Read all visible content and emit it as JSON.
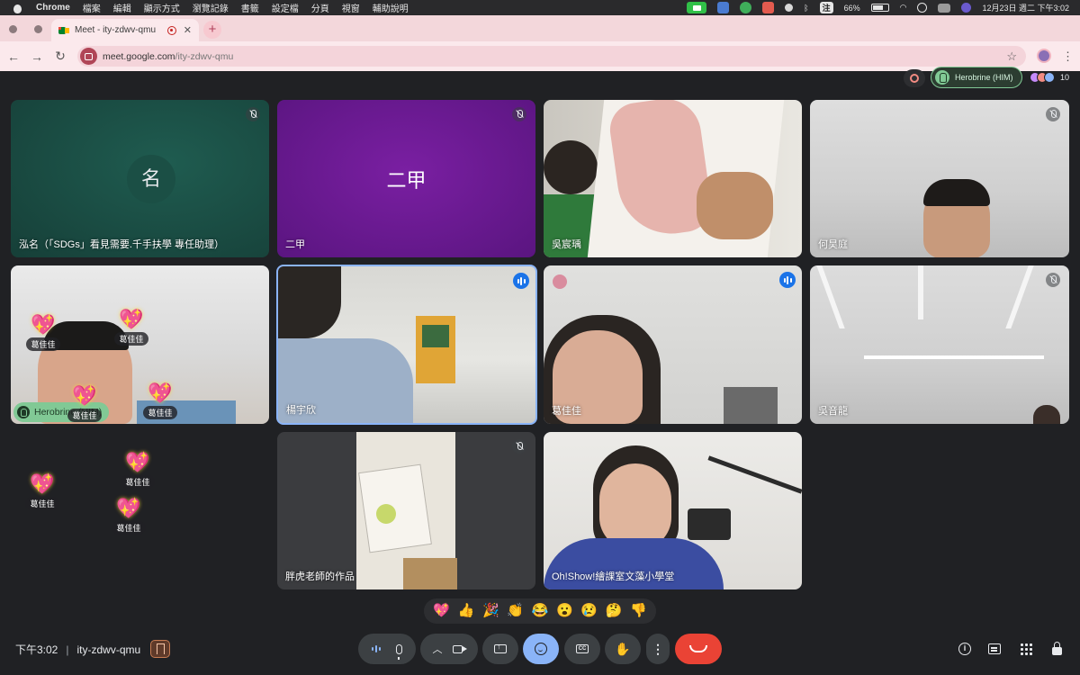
{
  "menubar": {
    "app": "Chrome",
    "items": [
      "檔案",
      "編輯",
      "顯示方式",
      "瀏覽記錄",
      "書籤",
      "設定檔",
      "分頁",
      "視窗",
      "輔助說明"
    ],
    "input_method": "注",
    "battery": "66%",
    "datetime": "12月23日 週二 下午3:02"
  },
  "browser": {
    "tab_title": "Meet - ity-zdwv-qmu",
    "tab_close": "✕",
    "new_tab": "+",
    "url_host": "meet.google.com",
    "url_path": "/ity-zdwv-qmu"
  },
  "meet_top": {
    "hand_raised_name": "Herobrine (HIM)",
    "participant_count": "10"
  },
  "tiles": [
    {
      "name": "泓名（「SDGs」看見需要.千手扶學 專任助理）",
      "avatar": "名",
      "muted": true
    },
    {
      "name": "二甲",
      "avatar": "二甲",
      "muted": true
    },
    {
      "name": "吳宸瑀",
      "muted": false
    },
    {
      "name": "何昊庭",
      "muted": true
    },
    {
      "name": "Herobrine (HIM)",
      "muted": true,
      "hand_raised": true
    },
    {
      "name": "楊宇欣",
      "speaking": true
    },
    {
      "name": "葛佳佳",
      "speaking": true
    },
    {
      "name": "吳音龍",
      "muted": true
    },
    {
      "name": "胖虎老師的作品",
      "muted": true
    },
    {
      "name": "Oh!Show!繪課室文藻小學堂",
      "muted": false
    }
  ],
  "reactions": {
    "sender": "葛佳佳",
    "emoji": "💖"
  },
  "emoji_bar": [
    "💖",
    "👍",
    "🎉",
    "👏",
    "😂",
    "😮",
    "😢",
    "🤔",
    "👎"
  ],
  "bottom": {
    "time": "下午3:02",
    "separator": "|",
    "meeting_code": "ity-zdwv-qmu"
  },
  "colors": {
    "meet_bg": "#202124",
    "browser_theme": "#fbe9ec",
    "speaking_blue": "#1a73e8",
    "hand_green": "#81c995",
    "end_call_red": "#ea4335",
    "reaction_active": "#8ab4f8"
  }
}
